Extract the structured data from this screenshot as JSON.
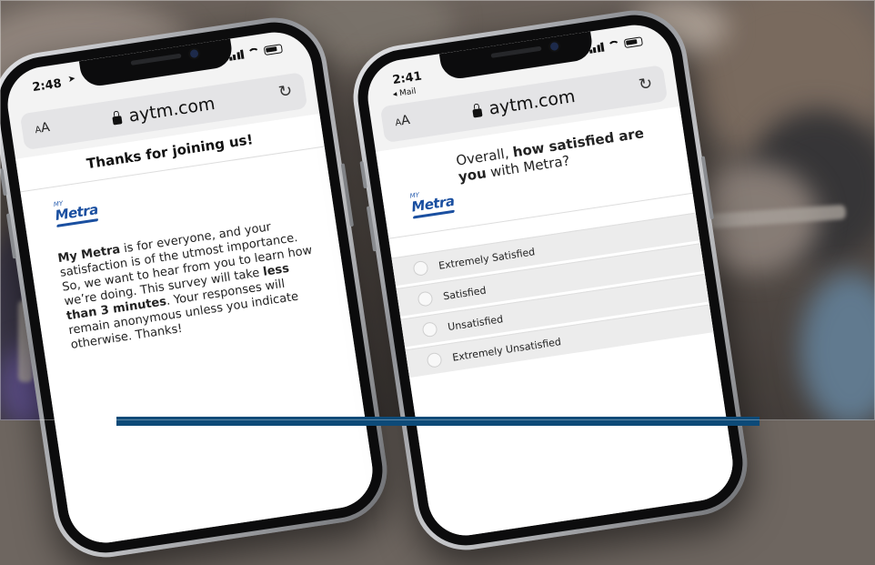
{
  "left_phone": {
    "status_time": "2:48",
    "url": "aytm.com",
    "text_size_label": "AA",
    "page_title": "Thanks for joining us!",
    "logo_small": "MY",
    "logo_name": "Metra",
    "intro": {
      "brand": "My Metra",
      "text_1": " is for everyone, and your satisfaction is of the utmost importance. So, we want to hear from you to learn how we’re doing. This survey will take ",
      "duration": "less than 3 minutes",
      "text_2": ". Your responses will remain anonymous unless you indicate otherwise. Thanks!"
    }
  },
  "right_phone": {
    "status_time": "2:41",
    "back_label": "◂ Mail",
    "url": "aytm.com",
    "text_size_label": "AA",
    "logo_small": "MY",
    "logo_name": "Metra",
    "question": {
      "prefix": "Overall, ",
      "bold": "how satisfied are you",
      "suffix": " with Metra?"
    },
    "options": [
      "Extremely Satisfied",
      "Satisfied",
      "Unsatisfied",
      "Extremely Unsatisfied"
    ]
  },
  "colors": {
    "metra_blue": "#1a4fa0",
    "banner": "#0d4a78"
  },
  "icons": {
    "lock": "lock-icon",
    "reload": "reload-icon",
    "signal": "signal-icon",
    "wifi": "wifi-icon",
    "battery": "battery-icon",
    "location": "location-arrow-icon"
  }
}
